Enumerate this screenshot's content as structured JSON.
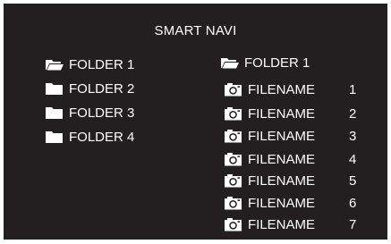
{
  "title": "SMART NAVI",
  "colors": {
    "background": "#231f20",
    "foreground": "#ffffff"
  },
  "left_panel": {
    "items": [
      {
        "label": "FOLDER 1",
        "icon": "folder-open-icon"
      },
      {
        "label": "FOLDER 2",
        "icon": "folder-icon"
      },
      {
        "label": "FOLDER 3",
        "icon": "folder-icon"
      },
      {
        "label": "FOLDER 4",
        "icon": "folder-icon"
      }
    ]
  },
  "right_panel": {
    "folder": {
      "label": "FOLDER 1",
      "icon": "folder-open-icon"
    },
    "files": [
      {
        "label": "FILENAME",
        "number": "1",
        "icon": "camera-icon"
      },
      {
        "label": "FILENAME",
        "number": "2",
        "icon": "camera-icon"
      },
      {
        "label": "FILENAME",
        "number": "3",
        "icon": "camera-icon"
      },
      {
        "label": "FILENAME",
        "number": "4",
        "icon": "camera-icon"
      },
      {
        "label": "FILENAME",
        "number": "5",
        "icon": "camera-icon"
      },
      {
        "label": "FILENAME",
        "number": "6",
        "icon": "camera-icon"
      },
      {
        "label": "FILENAME",
        "number": "7",
        "icon": "camera-icon"
      }
    ]
  }
}
